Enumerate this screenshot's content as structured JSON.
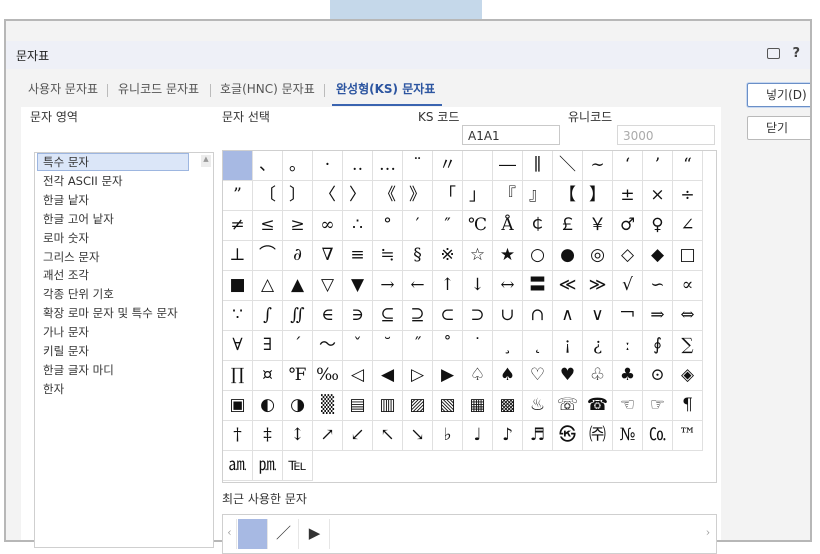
{
  "dialog": {
    "title": "문자표",
    "help": "?",
    "insert_button": "넣기(D)",
    "close_button": "닫기"
  },
  "tabs": [
    {
      "label": "사용자 문자표",
      "active": false
    },
    {
      "label": "유니코드 문자표",
      "active": false
    },
    {
      "label": "호글(HNC) 문자표",
      "active": false
    },
    {
      "label": "완성형(KS) 문자표",
      "active": true
    }
  ],
  "left": {
    "label": "문자 영역",
    "items": [
      "특수 문자",
      "전각 ASCII 문자",
      "한글 낱자",
      "한글 고어 낱자",
      "로마 숫자",
      "그리스 문자",
      "괘선 조각",
      "각종 단위 기호",
      "확장 로마 문자 및 특수 문자",
      "가나 문자",
      "키릴 문자",
      "한글 글자 마디",
      "한자"
    ],
    "selected_index": 0
  },
  "selector": {
    "label": "문자 선택",
    "ks_label": "KS 코드",
    "ks_value": "A1A1",
    "unicode_label": "유니코드",
    "unicode_value": "3000"
  },
  "chars": [
    " ",
    "、",
    "。",
    "·",
    "‥",
    "…",
    "¨",
    "〃",
    "­",
    "―",
    "∥",
    "＼",
    "∼",
    "‘",
    "’",
    "“",
    "”",
    "〔",
    "〕",
    "〈",
    "〉",
    "《",
    "》",
    "「",
    "」",
    "『",
    "』",
    "【",
    "】",
    "±",
    "×",
    "÷",
    "≠",
    "≤",
    "≥",
    "∞",
    "∴",
    "°",
    "′",
    "″",
    "℃",
    "Å",
    "￠",
    "￡",
    "￥",
    "♂",
    "♀",
    "∠",
    "⊥",
    "⌒",
    "∂",
    "∇",
    "≡",
    "≒",
    "§",
    "※",
    "☆",
    "★",
    "○",
    "●",
    "◎",
    "◇",
    "◆",
    "□",
    "■",
    "△",
    "▲",
    "▽",
    "▼",
    "→",
    "←",
    "↑",
    "↓",
    "↔",
    "〓",
    "≪",
    "≫",
    "√",
    "∽",
    "∝",
    "∵",
    "∫",
    "∬",
    "∈",
    "∋",
    "⊆",
    "⊇",
    "⊂",
    "⊃",
    "∪",
    "∩",
    "∧",
    "∨",
    "￢",
    "⇒",
    "⇔",
    "∀",
    "∃",
    "´",
    "～",
    "ˇ",
    "˘",
    "˝",
    "˚",
    "˙",
    "¸",
    "˛",
    "¡",
    "¿",
    "ː",
    "∮",
    "∑",
    "∏",
    "¤",
    "℉",
    "‰",
    "◁",
    "◀",
    "▷",
    "▶",
    "♤",
    "♠",
    "♡",
    "♥",
    "♧",
    "♣",
    "⊙",
    "◈",
    "▣",
    "◐",
    "◑",
    "▒",
    "▤",
    "▥",
    "▨",
    "▧",
    "▦",
    "▩",
    "♨",
    "☏",
    "☎",
    "☜",
    "☞",
    "¶",
    "†",
    "‡",
    "↕",
    "↗",
    "↙",
    "↖",
    "↘",
    "♭",
    "♩",
    "♪",
    "♬",
    "㉿",
    "㈜",
    "№",
    "㏇",
    "™",
    "㏂",
    "㏘",
    "℡"
  ],
  "selected_char_index": 0,
  "recent": {
    "label": "최근 사용한 문자",
    "items": [
      " ",
      "／",
      "▶"
    ]
  }
}
